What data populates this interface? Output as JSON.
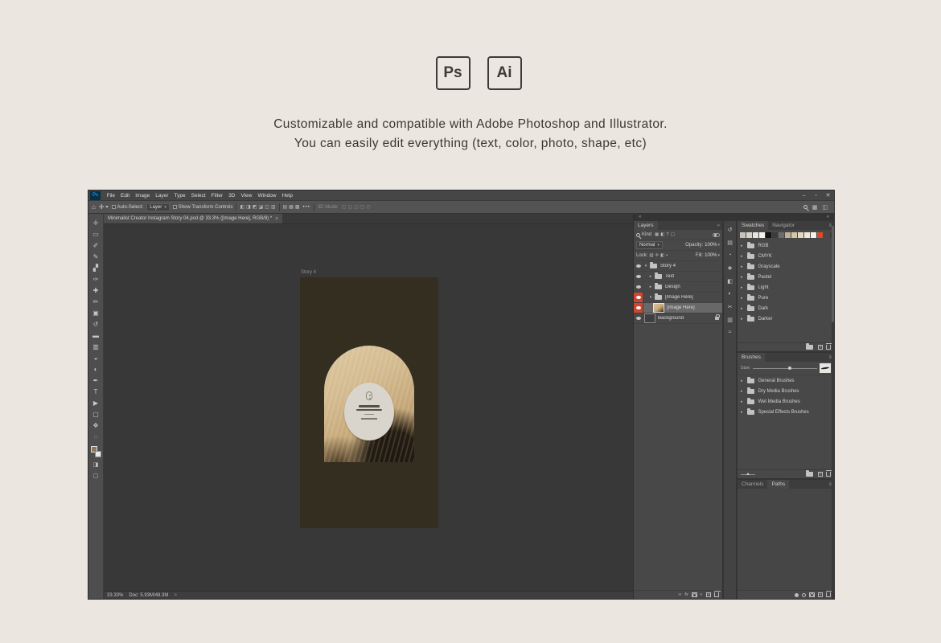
{
  "header": {
    "badges": [
      {
        "label": "Ps"
      },
      {
        "label": "Ai"
      }
    ],
    "line1": "Customizable and compatible with Adobe Photoshop and Illustrator.",
    "line2": "You can easily edit everything (text, color, photo, shape, etc)"
  },
  "ps": {
    "logo": "Ps",
    "menu": [
      "File",
      "Edit",
      "Image",
      "Layer",
      "Type",
      "Select",
      "Filter",
      "3D",
      "View",
      "Window",
      "Help"
    ],
    "window_controls": [
      {
        "name": "minimize",
        "glyph": "–"
      },
      {
        "name": "restore",
        "glyph": "▫"
      },
      {
        "name": "close",
        "glyph": "✕"
      }
    ],
    "options": {
      "auto_select": "Auto-Select:",
      "auto_select_value": "Layer",
      "show_transform": "Show Transform Controls",
      "more": "•••",
      "mode_label": "3D Mode:"
    },
    "doc_tab": {
      "title": "Minimalist Creator Instagram Story 04.psd @ 33.3% ([Image Here], RGB/8) *",
      "close": "×"
    },
    "tools": [
      {
        "name": "move",
        "glyph": "✛"
      },
      {
        "name": "marquee",
        "glyph": "▭"
      },
      {
        "name": "lasso",
        "glyph": "✐"
      },
      {
        "name": "quick-selection",
        "glyph": "✎"
      },
      {
        "name": "crop",
        "glyph": "▞"
      },
      {
        "name": "eyedropper",
        "glyph": "✑"
      },
      {
        "name": "healing-brush",
        "glyph": "✚"
      },
      {
        "name": "brush",
        "glyph": "✏"
      },
      {
        "name": "clone-stamp",
        "glyph": "▣"
      },
      {
        "name": "history-brush",
        "glyph": "↺"
      },
      {
        "name": "eraser",
        "glyph": "▬"
      },
      {
        "name": "gradient",
        "glyph": "▥"
      },
      {
        "name": "blur",
        "glyph": "◒"
      },
      {
        "name": "dodge",
        "glyph": "◐"
      },
      {
        "name": "pen",
        "glyph": "✒"
      },
      {
        "name": "type",
        "glyph": "T"
      },
      {
        "name": "path-selection",
        "glyph": "▶"
      },
      {
        "name": "shape",
        "glyph": "▢"
      },
      {
        "name": "hand",
        "glyph": "✥"
      },
      {
        "name": "zoom",
        "glyph": "◌"
      }
    ],
    "artboard": {
      "label": "Story 4"
    },
    "status": {
      "zoom": "33.33%",
      "doc": "Doc: 5.93M/48.3M"
    },
    "layers": {
      "title": "Layers",
      "filter_label": "Kind",
      "blend_mode": "Normal",
      "opacity_label": "Opacity:",
      "opacity_value": "100%",
      "lock_label": "Lock:",
      "fill_label": "Fill:",
      "fill_value": "100%",
      "rows": [
        {
          "name": "Story 4",
          "is_group": true,
          "expanded": true
        },
        {
          "name": "Text",
          "is_group": true,
          "i1": true
        },
        {
          "name": "Design",
          "is_group": true,
          "i1": true
        },
        {
          "name": "[Image Here]",
          "is_group": true,
          "expanded": true,
          "red": true,
          "i1": true
        },
        {
          "name": "[Image Here]",
          "is_image": true,
          "red": true,
          "selected": true,
          "i2": true
        },
        {
          "name": "Background",
          "is_background": true
        }
      ]
    },
    "dock_icons": [
      {
        "name": "history",
        "glyph": "↺"
      },
      {
        "name": "properties",
        "glyph": "▤"
      },
      {
        "name": "adjustments",
        "glyph": "◔"
      },
      {
        "name": "libraries",
        "glyph": "❖"
      },
      {
        "name": "color",
        "glyph": "◧"
      },
      {
        "name": "info",
        "glyph": "◐"
      },
      {
        "name": "glyphs",
        "glyph": "✂"
      },
      {
        "name": "layer-comps",
        "glyph": "▥"
      },
      {
        "name": "timeline",
        "glyph": "≈"
      }
    ],
    "swatches": {
      "tabs": [
        "Swatches",
        "Navigator"
      ],
      "colors": [
        "#c9c2b8",
        "#d9d2c8",
        "#e9e4db",
        "#f6f3ed",
        "#141414",
        "#3c3c3c",
        "#6b6b6b",
        "#c3b095",
        "#d5c5aa",
        "#e4d8c2",
        "#efe8d9",
        "#f6f2ea",
        "#e04a22"
      ],
      "groups": [
        "RGB",
        "CMYK",
        "Grayscale",
        "Pastel",
        "Light",
        "Pure",
        "Dark",
        "Darker"
      ]
    },
    "brushes": {
      "title": "Brushes",
      "size_label": "Size:",
      "groups": [
        "General Brushes",
        "Dry Media Brushes",
        "Wet Media Brushes",
        "Special Effects Brushes"
      ]
    },
    "channels": {
      "tabs": [
        "Channels",
        "Paths"
      ]
    }
  }
}
